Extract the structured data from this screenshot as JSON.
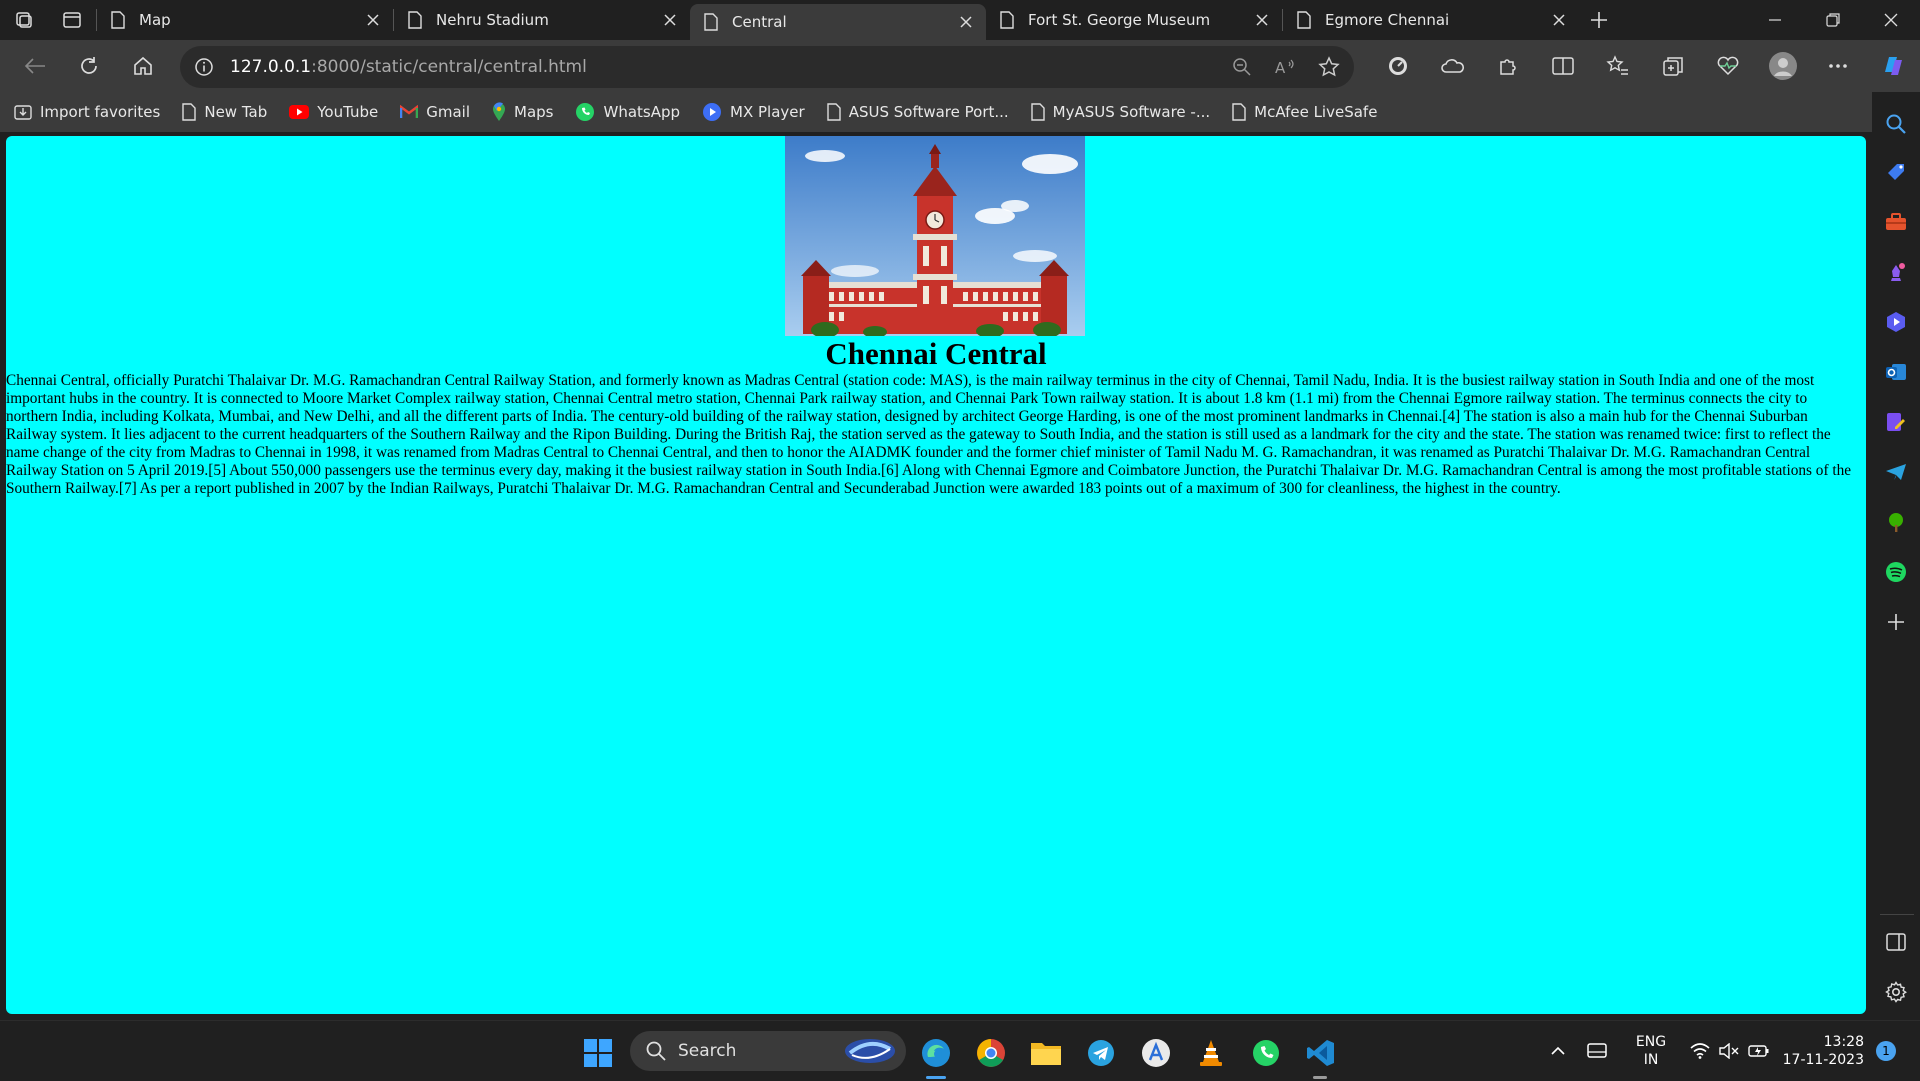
{
  "browser": {
    "tabs": [
      {
        "title": "Map",
        "active": false
      },
      {
        "title": "Nehru Stadium",
        "active": false
      },
      {
        "title": "Central",
        "active": true
      },
      {
        "title": "Fort St. George Museum",
        "active": false
      },
      {
        "title": "Egmore Chennai",
        "active": false
      }
    ],
    "url_host": "127.0.0.1",
    "url_rest": ":8000/static/central/central.html"
  },
  "bookmarks": [
    {
      "label": "Import favorites",
      "icon": "import-icon"
    },
    {
      "label": "New Tab",
      "icon": "page-icon"
    },
    {
      "label": "YouTube",
      "icon": "youtube-icon"
    },
    {
      "label": "Gmail",
      "icon": "gmail-icon"
    },
    {
      "label": "Maps",
      "icon": "maps-icon"
    },
    {
      "label": "WhatsApp",
      "icon": "whatsapp-icon"
    },
    {
      "label": "MX Player",
      "icon": "mxplayer-icon"
    },
    {
      "label": "ASUS Software Port...",
      "icon": "page-icon"
    },
    {
      "label": "MyASUS Software -...",
      "icon": "page-icon"
    },
    {
      "label": "McAfee LiveSafe",
      "icon": "page-icon"
    }
  ],
  "page": {
    "title": "Chennai Central",
    "body": "Chennai Central, officially Puratchi Thalaivar Dr. M.G. Ramachandran Central Railway Station, and formerly known as Madras Central (station code: MAS), is the main railway terminus in the city of Chennai, Tamil Nadu, India. It is the busiest railway station in South India and one of the most important hubs in the country. It is connected to Moore Market Complex railway station, Chennai Central metro station, Chennai Park railway station, and Chennai Park Town railway station. It is about 1.8 km (1.1 mi) from the Chennai Egmore railway station. The terminus connects the city to northern India, including Kolkata, Mumbai, and New Delhi, and all the different parts of India. The century-old building of the railway station, designed by architect George Harding, is one of the most prominent landmarks in Chennai.[4] The station is also a main hub for the Chennai Suburban Railway system. It lies adjacent to the current headquarters of the Southern Railway and the Ripon Building. During the British Raj, the station served as the gateway to South India, and the station is still used as a landmark for the city and the state. The station was renamed twice: first to reflect the name change of the city from Madras to Chennai in 1998, it was renamed from Madras Central to Chennai Central, and then to honor the AIADMK founder and the former chief minister of Tamil Nadu M. G. Ramachandran, it was renamed as Puratchi Thalaivar Dr. M.G. Ramachandran Central Railway Station on 5 April 2019.[5] About 550,000 passengers use the terminus every day, making it the busiest railway station in South India.[6] Along with Chennai Egmore and Coimbatore Junction, the Puratchi Thalaivar Dr. M.G. Ramachandran Central is among the most profitable stations of the Southern Railway.[7] As per a report published in 2007 by the Indian Railways, Puratchi Thalaivar Dr. M.G. Ramachandran Central and Secunderabad Junction were awarded 183 points out of a maximum of 300 for cleanliness, the highest in the country.",
    "background": "#00ffff"
  },
  "taskbar": {
    "search_label": "Search",
    "lang_top": "ENG",
    "lang_bottom": "IN",
    "time": "13:28",
    "date": "17-11-2023",
    "notification_count": "1"
  }
}
